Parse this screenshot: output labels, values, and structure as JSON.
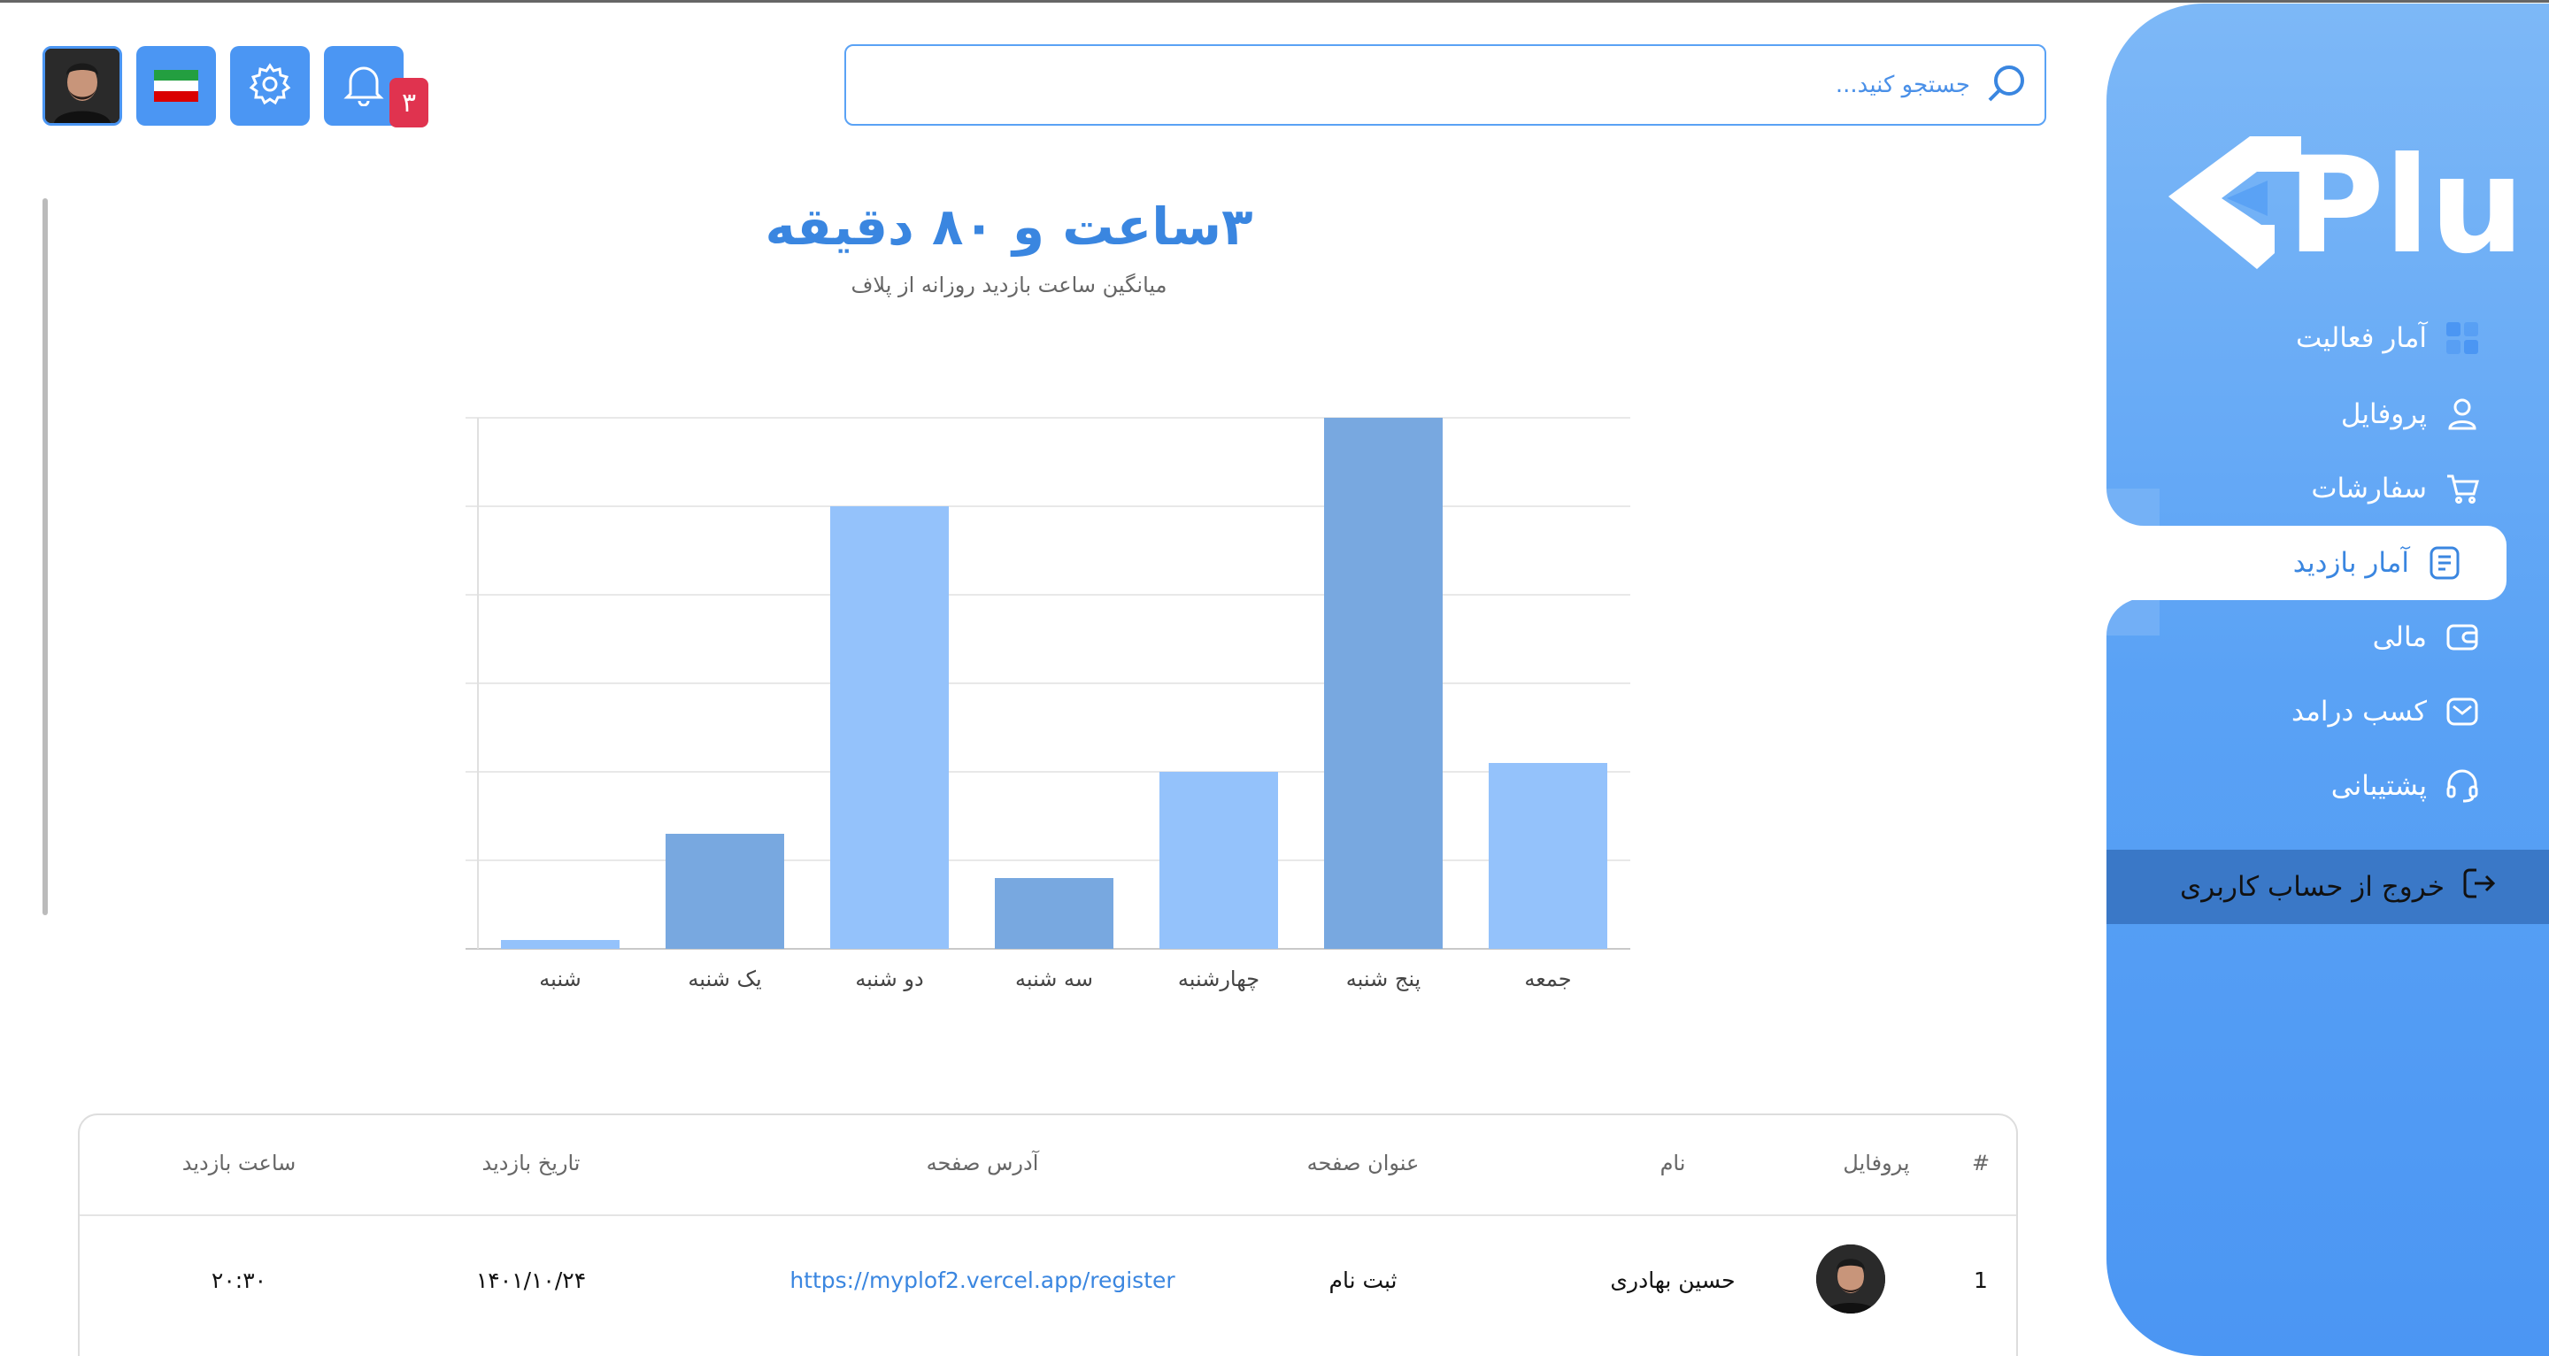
{
  "header": {
    "search_placeholder": "جستجو کنید...",
    "notification_count": "۳",
    "flag_colors": [
      "#239f40",
      "#ffffff",
      "#da0000"
    ]
  },
  "sidebar": {
    "logo_text": "Pluf",
    "items": [
      {
        "label": "آمار فعالیت",
        "icon": "grid-icon"
      },
      {
        "label": "پروفایل",
        "icon": "user-icon"
      },
      {
        "label": "سفارشات",
        "icon": "cart-icon"
      },
      {
        "label": "آمار بازدید",
        "icon": "document-icon",
        "active": true
      },
      {
        "label": "مالی",
        "icon": "wallet-icon"
      },
      {
        "label": "کسب درامد",
        "icon": "mail-icon"
      },
      {
        "label": "پشتیبانی",
        "icon": "headset-icon"
      }
    ],
    "logout_label": "خروج از حساب کاربری"
  },
  "summary": {
    "headline": "۳ساعت و ۸۰ دقیقه",
    "subtitle": "میانگین ساعت بازدید روزانه از پلاف"
  },
  "chart_data": {
    "type": "bar",
    "categories": [
      "شنبه",
      "یک شنبه",
      "دو شنبه",
      "سه شنبه",
      "چهارشنبه",
      "پنج شنبه",
      "جمعه"
    ],
    "values": [
      0.1,
      1.3,
      5.0,
      0.8,
      2.0,
      6.0,
      2.1
    ],
    "ylim": [
      0,
      6
    ],
    "gridlines": 6,
    "colors": [
      "#94c2fb",
      "#78a8e0",
      "#94c2fb",
      "#78a8e0",
      "#94c2fb",
      "#78a8e0",
      "#94c2fb"
    ],
    "title": "",
    "xlabel": "",
    "ylabel": ""
  },
  "table": {
    "headers": {
      "index": "#",
      "profile": "پروفایل",
      "name": "نام",
      "page_title": "عنوان صفحه",
      "page_address": "آدرس صفحه",
      "visit_date": "تاریخ بازدید",
      "visit_time": "ساعت بازدید"
    },
    "rows": [
      {
        "index": "1",
        "name": "حسین بهادری",
        "page_title": "ثبت نام",
        "page_address": "https://myplof2.vercel.app/register",
        "visit_date": "۱۴۰۱/۱۰/۲۴",
        "visit_time": "۲۰:۳۰"
      }
    ]
  }
}
